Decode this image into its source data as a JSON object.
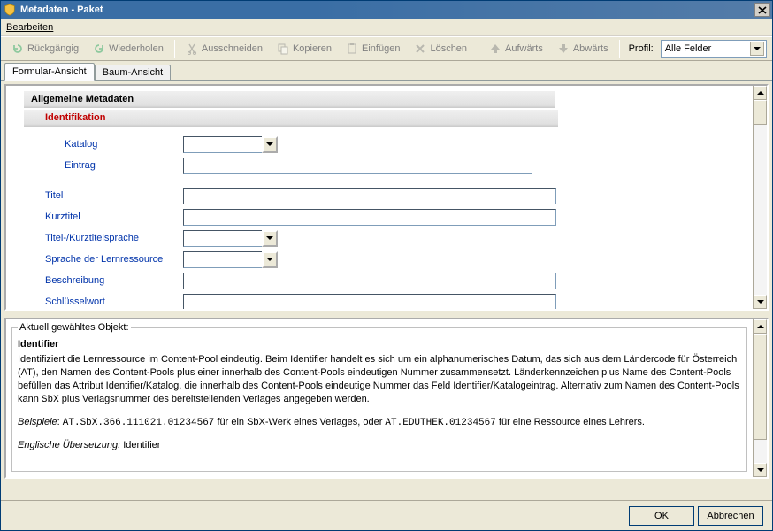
{
  "titlebar": {
    "title": "Metadaten - Paket"
  },
  "menubar": {
    "edit": "Bearbeiten"
  },
  "toolbar": {
    "undo": "Rückgängig",
    "redo": "Wiederholen",
    "cut": "Ausschneiden",
    "copy": "Kopieren",
    "paste": "Einfügen",
    "delete": "Löschen",
    "up": "Aufwärts",
    "down": "Abwärts",
    "profil_label": "Profil:",
    "profil_value": "Alle Felder"
  },
  "tabs": {
    "form": "Formular-Ansicht",
    "tree": "Baum-Ansicht"
  },
  "form": {
    "section_general": "Allgemeine Metadaten",
    "section_ident": "Identifikation",
    "labels": {
      "katalog": "Katalog",
      "eintrag": "Eintrag",
      "titel": "Titel",
      "kurztitel": "Kurztitel",
      "titelsprache": "Titel-/Kurztitelsprache",
      "sprache": "Sprache der Lernressource",
      "beschreibung": "Beschreibung",
      "schluesselwort": "Schlüsselwort"
    },
    "values": {
      "katalog": "",
      "eintrag": "",
      "titel": "",
      "kurztitel": "",
      "titelsprache": "",
      "sprache": "",
      "beschreibung": "",
      "schluesselwort": ""
    }
  },
  "info": {
    "legend": "Aktuell gewähltes Objekt:",
    "title": "Identifier",
    "body": "Identifiziert die Lernressource im Content-Pool eindeutig. Beim Identifier handelt es sich um ein alphanumerisches Datum, das sich aus dem Ländercode für Österreich (AT), den Namen des Content-Pools plus einer innerhalb des Content-Pools eindeutigen Nummer zusammensetzt. Länderkennzeichen plus Name des Content-Pools befüllen das Attribut Identifier/Katalog, die innerhalb des Content-Pools eindeutige Nummer das Feld Identifier/Katalogeintrag. Alternativ zum Namen des Content-Pools kann ",
    "body_code": "SbX",
    "body2": " plus Verlagsnummer des bereitstellenden Verlages angegeben werden.",
    "examples_label": "Beispiele",
    "example1_code": "AT.SbX.366.111021.01234567",
    "example1_text": " für ein SbX-Werk eines Verlages, oder ",
    "example2_code": "AT.EDUTHEK.01234567",
    "example2_text": " für eine Ressource eines Lehrers.",
    "english_label": "Englische Übersetzung",
    "english_value": "Identifier"
  },
  "buttons": {
    "ok": "OK",
    "cancel": "Abbrechen"
  }
}
